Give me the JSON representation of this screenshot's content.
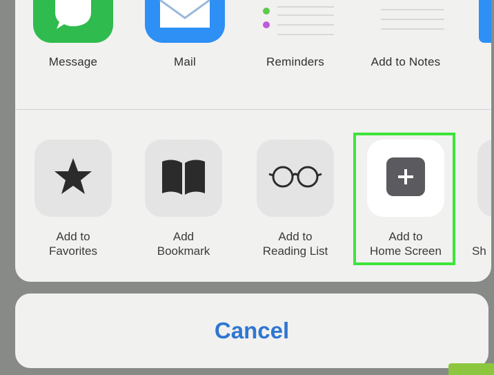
{
  "share_apps": [
    {
      "label": "Message",
      "icon": "message-icon",
      "color": "#2fbb4d"
    },
    {
      "label": "Mail",
      "icon": "mail-icon",
      "color": "#2e8ff5"
    },
    {
      "label": "Reminders",
      "icon": "reminders-icon",
      "color": "#f4f4f4"
    },
    {
      "label": "Add to Notes",
      "icon": "notes-icon",
      "color": "#f4f4f4"
    }
  ],
  "actions": [
    {
      "line1": "Add to",
      "line2": "Favorites",
      "icon": "star-icon"
    },
    {
      "line1": "Add",
      "line2": "Bookmark",
      "icon": "book-icon"
    },
    {
      "line1": "Add to",
      "line2": "Reading List",
      "icon": "glasses-icon"
    },
    {
      "line1": "Add to",
      "line2": "Home Screen",
      "icon": "plus-square-icon",
      "highlighted": true
    },
    {
      "line1": "Sh",
      "line2": "",
      "icon": "share-icon"
    }
  ],
  "cancel_label": "Cancel",
  "colors": {
    "accent": "#2f76d2",
    "highlight": "#3ee53a"
  }
}
